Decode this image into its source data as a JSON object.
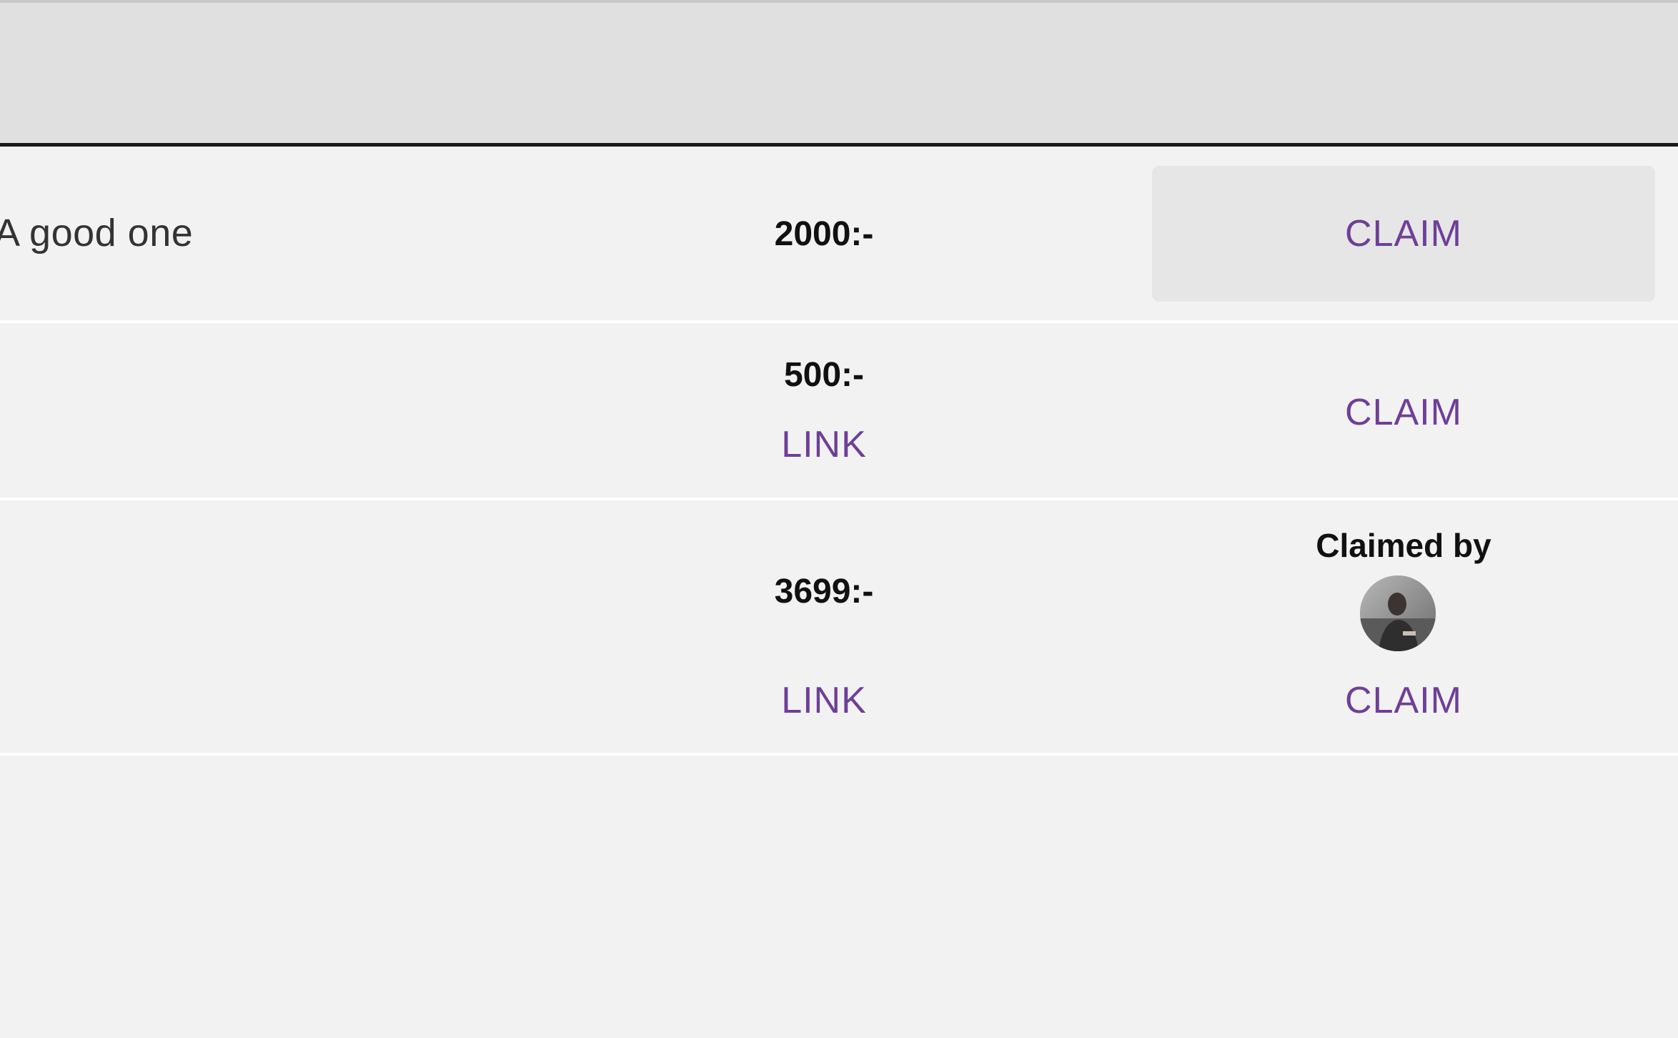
{
  "rows": [
    {
      "description": "A good one",
      "price": "2000:-",
      "claim_label": "CLAIM"
    },
    {
      "description": "",
      "price": "500:-",
      "link_label": "LINK",
      "claim_label": "CLAIM"
    },
    {
      "description": "",
      "price": "3699:-",
      "link_label": "LINK",
      "claimed_by_label": "Claimed by",
      "claim_label": "CLAIM"
    }
  ],
  "colors": {
    "accent": "#6e3f98",
    "background": "#f2f2f2",
    "header": "#e0e0e0",
    "highlight": "#e6e6e6"
  },
  "icons": {
    "avatar": "user-avatar"
  }
}
